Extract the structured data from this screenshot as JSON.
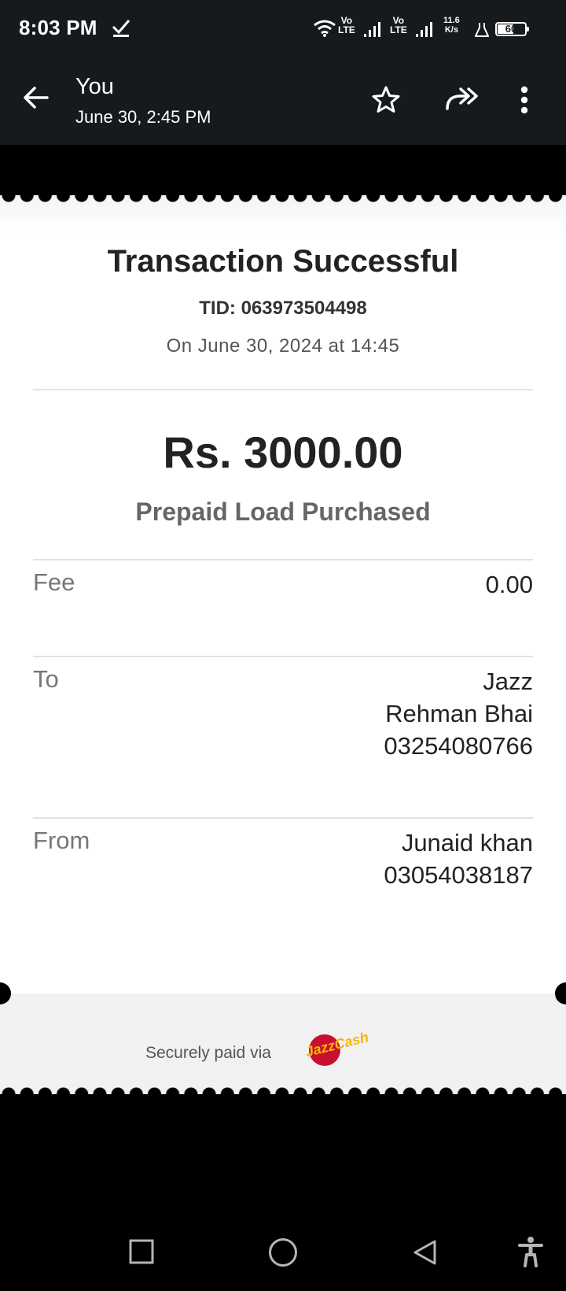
{
  "status_bar": {
    "time": "8:03 PM",
    "volte1_top": "Vo",
    "volte1_bottom": "LTE",
    "volte2_top": "Vo",
    "volte2_bottom": "LTE",
    "speed_top": "11.6",
    "speed_bottom": "K/s",
    "battery_percent": "60",
    "battery_level": 0.6
  },
  "app_bar": {
    "sender": "You",
    "date": "June 30, 2:45 PM"
  },
  "receipt": {
    "title": "Transaction Successful",
    "tid": "TID: 063973504498",
    "datetime": "On June 30, 2024 at 14:45",
    "amount": "Rs. 3000.00",
    "description": "Prepaid Load Purchased",
    "fee_label": "Fee",
    "fee_value": "0.00",
    "to_label": "To",
    "to_line1": "Jazz",
    "to_line2": "Rehman Bhai",
    "to_line3": "03254080766",
    "from_label": "From",
    "from_line1": "Junaid khan",
    "from_line2": "03054038187",
    "footer_text": "Securely paid via",
    "logo_text": "JazzCash"
  },
  "colors": {
    "bar_bg": "#161a1d",
    "logo_red": "#c8102e",
    "logo_yellow": "#f5b800"
  }
}
